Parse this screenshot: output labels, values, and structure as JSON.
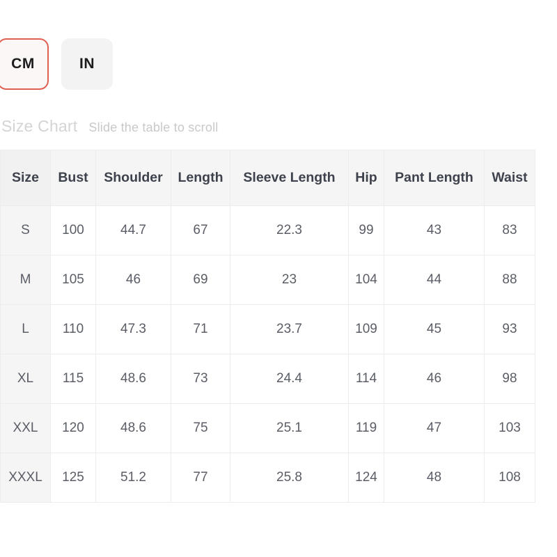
{
  "unit_toggle": {
    "options": [
      {
        "label": "CM",
        "selected": true
      },
      {
        "label": "IN",
        "selected": false
      }
    ],
    "selected_value": "CM",
    "selected_border_color": "#e0604f",
    "button_background": "#f3f3f4"
  },
  "caption": {
    "title": "Size Chart",
    "hint": "Slide the table to scroll"
  },
  "size_table": {
    "columns": [
      "Size",
      "Bust",
      "Shoulder",
      "Length",
      "Sleeve Length",
      "Hip",
      "Pant Length",
      "Waist"
    ],
    "rows": [
      {
        "size": "S",
        "bust": "100",
        "shoulder": "44.7",
        "length": "67",
        "sleeve_length": "22.3",
        "hip": "99",
        "pant_length": "43",
        "waist": "83"
      },
      {
        "size": "M",
        "bust": "105",
        "shoulder": "46",
        "length": "69",
        "sleeve_length": "23",
        "hip": "104",
        "pant_length": "44",
        "waist": "88"
      },
      {
        "size": "L",
        "bust": "110",
        "shoulder": "47.3",
        "length": "71",
        "sleeve_length": "23.7",
        "hip": "109",
        "pant_length": "45",
        "waist": "93"
      },
      {
        "size": "XL",
        "bust": "115",
        "shoulder": "48.6",
        "length": "73",
        "sleeve_length": "24.4",
        "hip": "114",
        "pant_length": "46",
        "waist": "98"
      },
      {
        "size": "XXL",
        "bust": "120",
        "shoulder": "48.6",
        "length": "75",
        "sleeve_length": "25.1",
        "hip": "119",
        "pant_length": "47",
        "waist": "103"
      },
      {
        "size": "XXXL",
        "bust": "125",
        "shoulder": "51.2",
        "length": "77",
        "sleeve_length": "25.8",
        "hip": "124",
        "pant_length": "48",
        "waist": "108"
      }
    ]
  }
}
